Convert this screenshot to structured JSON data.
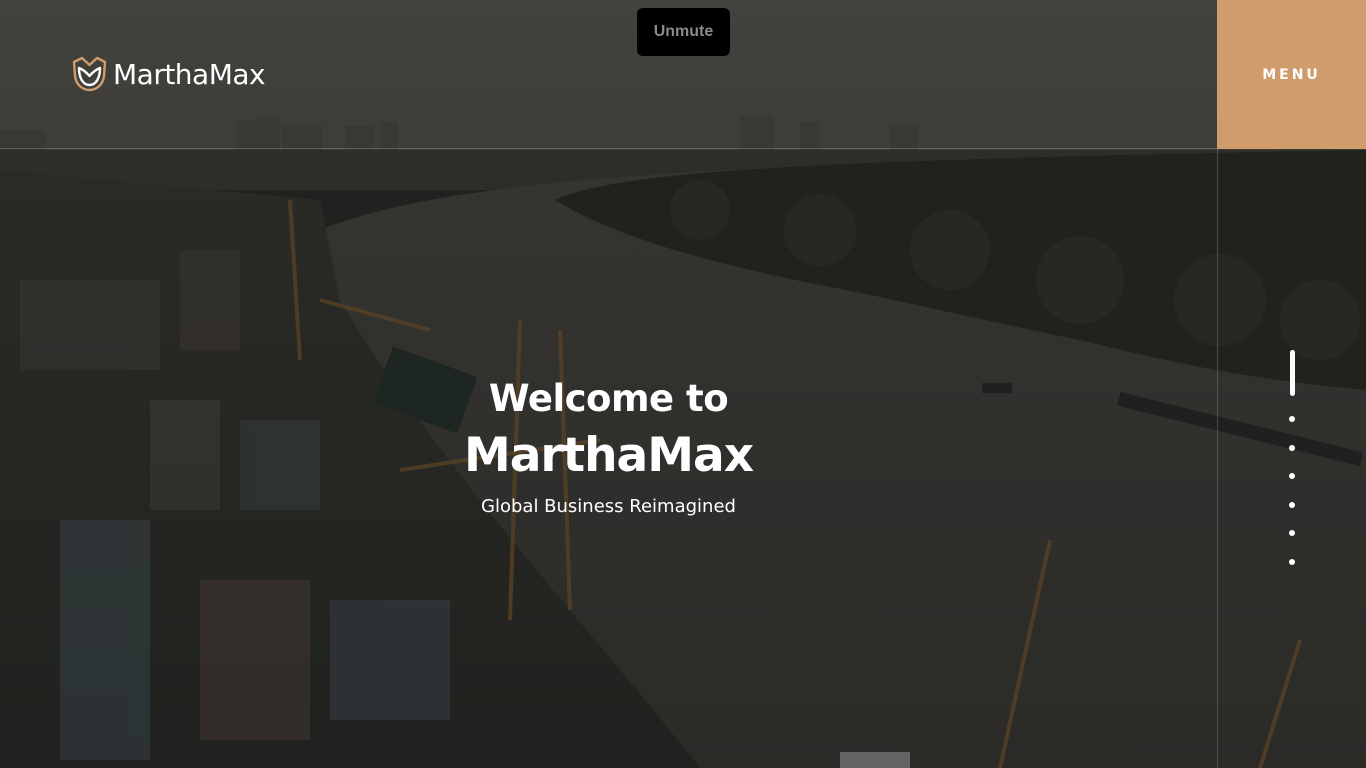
{
  "header": {
    "brand": "MarthaMax",
    "menu_label": "MENU"
  },
  "video": {
    "unmute_label": "Unmute"
  },
  "hero": {
    "welcome": "Welcome to",
    "brand": "MarthaMax",
    "tagline": "Global Business Reimagined"
  },
  "pagination": {
    "total_slides": 7,
    "active_index": 0
  },
  "colors": {
    "accent": "#d19c6c",
    "text": "#ffffff",
    "unmute_bg": "#000000"
  },
  "icons": {
    "logo": "tulip-shield-icon"
  }
}
